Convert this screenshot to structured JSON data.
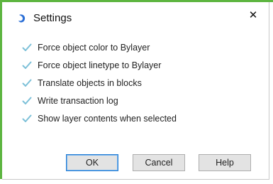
{
  "dialog": {
    "title": "Settings",
    "close_glyph": "✕",
    "icon": "settings-app-icon"
  },
  "options": [
    {
      "label": "Force object color to Bylayer",
      "checked": true
    },
    {
      "label": "Force object linetype to Bylayer",
      "checked": true
    },
    {
      "label": "Translate objects in blocks",
      "checked": true
    },
    {
      "label": "Write transaction log",
      "checked": true
    },
    {
      "label": "Show layer contents when selected",
      "checked": true
    }
  ],
  "buttons": {
    "ok": "OK",
    "cancel": "Cancel",
    "help": "Help"
  },
  "colors": {
    "accent_green": "#5db540",
    "check_color": "#7cc0d8",
    "focus_blue": "#2a7fd4"
  }
}
